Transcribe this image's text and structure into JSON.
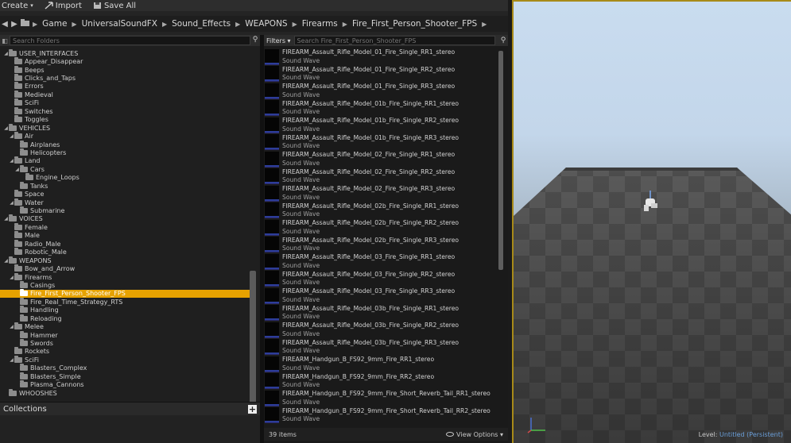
{
  "toolbar": {
    "create_label": "Create",
    "import_label": "Import",
    "saveall_label": "Save All"
  },
  "path": [
    "Game",
    "UniversalSoundFX",
    "Sound_Effects",
    "WEAPONS",
    "Firearms",
    "Fire_First_Person_Shooter_FPS"
  ],
  "folders": {
    "search_placeholder": "Search Folders",
    "items": [
      {
        "label": "USER_INTERFACES",
        "depth": 1,
        "open": true
      },
      {
        "label": "Appear_Disappear",
        "depth": 2
      },
      {
        "label": "Beeps",
        "depth": 2
      },
      {
        "label": "Clicks_and_Taps",
        "depth": 2
      },
      {
        "label": "Errors",
        "depth": 2
      },
      {
        "label": "Medieval",
        "depth": 2
      },
      {
        "label": "SciFi",
        "depth": 2
      },
      {
        "label": "Switches",
        "depth": 2
      },
      {
        "label": "Toggles",
        "depth": 2
      },
      {
        "label": "VEHICLES",
        "depth": 1,
        "open": true
      },
      {
        "label": "Air",
        "depth": 2,
        "open": true
      },
      {
        "label": "Airplanes",
        "depth": 3
      },
      {
        "label": "Helicopters",
        "depth": 3
      },
      {
        "label": "Land",
        "depth": 2,
        "open": true
      },
      {
        "label": "Cars",
        "depth": 3,
        "open": true
      },
      {
        "label": "Engine_Loops",
        "depth": 4
      },
      {
        "label": "Tanks",
        "depth": 3
      },
      {
        "label": "Space",
        "depth": 2
      },
      {
        "label": "Water",
        "depth": 2,
        "open": true
      },
      {
        "label": "Submarine",
        "depth": 3
      },
      {
        "label": "VOICES",
        "depth": 1,
        "open": true
      },
      {
        "label": "Female",
        "depth": 2
      },
      {
        "label": "Male",
        "depth": 2
      },
      {
        "label": "Radio_Male",
        "depth": 2
      },
      {
        "label": "Robotic_Male",
        "depth": 2
      },
      {
        "label": "WEAPONS",
        "depth": 1,
        "open": true
      },
      {
        "label": "Bow_and_Arrow",
        "depth": 2
      },
      {
        "label": "Firearms",
        "depth": 2,
        "open": true
      },
      {
        "label": "Casings",
        "depth": 3
      },
      {
        "label": "Fire_First_Person_Shooter_FPS",
        "depth": 3,
        "selected": true
      },
      {
        "label": "Fire_Real_Time_Strategy_RTS",
        "depth": 3
      },
      {
        "label": "Handling",
        "depth": 3
      },
      {
        "label": "Reloading",
        "depth": 3
      },
      {
        "label": "Melee",
        "depth": 2,
        "open": true
      },
      {
        "label": "Hammer",
        "depth": 3
      },
      {
        "label": "Swords",
        "depth": 3
      },
      {
        "label": "Rockets",
        "depth": 2
      },
      {
        "label": "SciFi",
        "depth": 2,
        "open": true
      },
      {
        "label": "Blasters_Complex",
        "depth": 3
      },
      {
        "label": "Blasters_Simple",
        "depth": 3
      },
      {
        "label": "Plasma_Cannons",
        "depth": 3
      },
      {
        "label": "WHOOSHES",
        "depth": 1
      }
    ]
  },
  "collections": {
    "label": "Collections"
  },
  "assets": {
    "filters_label": "Filters ▾",
    "search_placeholder": "Search Fire_First_Person_Shooter_FPS",
    "type_label": "Sound Wave",
    "items": [
      "FIREARM_Assault_Rifle_Model_01_Fire_Single_RR1_stereo",
      "FIREARM_Assault_Rifle_Model_01_Fire_Single_RR2_stereo",
      "FIREARM_Assault_Rifle_Model_01_Fire_Single_RR3_stereo",
      "FIREARM_Assault_Rifle_Model_01b_Fire_Single_RR1_stereo",
      "FIREARM_Assault_Rifle_Model_01b_Fire_Single_RR2_stereo",
      "FIREARM_Assault_Rifle_Model_01b_Fire_Single_RR3_stereo",
      "FIREARM_Assault_Rifle_Model_02_Fire_Single_RR1_stereo",
      "FIREARM_Assault_Rifle_Model_02_Fire_Single_RR2_stereo",
      "FIREARM_Assault_Rifle_Model_02_Fire_Single_RR3_stereo",
      "FIREARM_Assault_Rifle_Model_02b_Fire_Single_RR1_stereo",
      "FIREARM_Assault_Rifle_Model_02b_Fire_Single_RR2_stereo",
      "FIREARM_Assault_Rifle_Model_02b_Fire_Single_RR3_stereo",
      "FIREARM_Assault_Rifle_Model_03_Fire_Single_RR1_stereo",
      "FIREARM_Assault_Rifle_Model_03_Fire_Single_RR2_stereo",
      "FIREARM_Assault_Rifle_Model_03_Fire_Single_RR3_stereo",
      "FIREARM_Assault_Rifle_Model_03b_Fire_Single_RR1_stereo",
      "FIREARM_Assault_Rifle_Model_03b_Fire_Single_RR2_stereo",
      "FIREARM_Assault_Rifle_Model_03b_Fire_Single_RR3_stereo",
      "FIREARM_Handgun_B_FS92_9mm_Fire_RR1_stereo",
      "FIREARM_Handgun_B_FS92_9mm_Fire_RR2_stereo",
      "FIREARM_Handgun_B_FS92_9mm_Fire_Short_Reverb_Tail_RR1_stereo",
      "FIREARM_Handgun_B_FS92_9mm_Fire_Short_Reverb_Tail_RR2_stereo"
    ],
    "count_label": "39 items",
    "view_options_label": "View Options ▾"
  },
  "viewport": {
    "level_prefix": "Level:",
    "level_name": "Untitled (Persistent)"
  },
  "colors": {
    "selection": "#e6a200",
    "viewport_border": "#a88a18",
    "level_name": "#6a9ed8"
  }
}
